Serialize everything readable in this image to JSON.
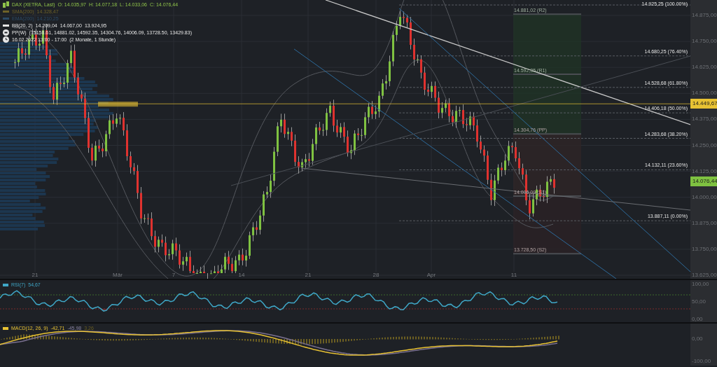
{
  "legend": [
    {
      "kind": "ohlc",
      "label": "DAX (XETRA, Last)",
      "values": [
        "O: 14.035,97",
        "H: 14.077,18",
        "L: 14.033,06",
        "C: 14.076,44"
      ],
      "color": "#8fc34a"
    },
    {
      "kind": "line",
      "label": "SMA(200)",
      "values": [
        "14.328,47"
      ],
      "color": "#6e6228"
    },
    {
      "kind": "line",
      "label": "EMA(200)",
      "values": [
        "14.210,25"
      ],
      "color": "#2b4a66"
    },
    {
      "kind": "line",
      "label": "BB(20, 2)",
      "values": [
        "14.209,04",
        "14.067,00",
        "13.924,95"
      ],
      "color": "#e6e6e6"
    },
    {
      "kind": "pivot",
      "label": "PP(W)",
      "values": [
        "(15158.61, 14881.02, 14592.35, 14304.76, 14006.09, 13728.50, 13429.83)"
      ],
      "color": "#e6e6e6"
    },
    {
      "kind": "time",
      "label": "16.02.2022 13:00 - 17:00",
      "values": [
        "(2 Monate, 1 Stunde)"
      ],
      "color": "#e6e6e6"
    }
  ],
  "fibonacci_levels": [
    "14.925,25 (100.00%)",
    "14.680,25 (76.40%)",
    "14.528,68 (61.80%)",
    "14.406,18 (50.00%)",
    "14.283,68 (38.20%)",
    "14.132,11 (23.60%)",
    "13.887,11 (0.00%)"
  ],
  "pivot_levels": [
    {
      "label": "14.881,02 (R2)",
      "kind": "resistance"
    },
    {
      "label": "14.592,35 (R1)",
      "kind": "resistance"
    },
    {
      "label": "14.304,76 (PP)",
      "kind": "pivot"
    },
    {
      "label": "14.006,09 (S1)",
      "kind": "support"
    },
    {
      "label": "13.728,50 (S2)",
      "kind": "support"
    }
  ],
  "price_axis": [
    "14.875,00",
    "14.750,00",
    "14.625,00",
    "14.500,00",
    "14.375,00",
    "14.250,00",
    "14.125,00",
    "14.000,00",
    "13.875,00",
    "13.750,00",
    "13.625,00"
  ],
  "price_markers": [
    {
      "text": "14.449,67",
      "color": "#e8c233"
    },
    {
      "text": "14.076,44",
      "color": "#7fc241"
    }
  ],
  "date_axis": [
    "21",
    "Mär",
    "7",
    "14",
    "21",
    "28",
    "Apr",
    "11"
  ],
  "rsi": {
    "label": "RSI(7)",
    "value": "54,67",
    "axis": [
      "100,00",
      "50,00",
      "0,00"
    ]
  },
  "macd": {
    "label": "MACD(12, 26, 9)",
    "values": [
      "-42,71",
      "-45,98",
      "3,26"
    ],
    "axis": [
      "0,00",
      "-100,00"
    ]
  }
}
